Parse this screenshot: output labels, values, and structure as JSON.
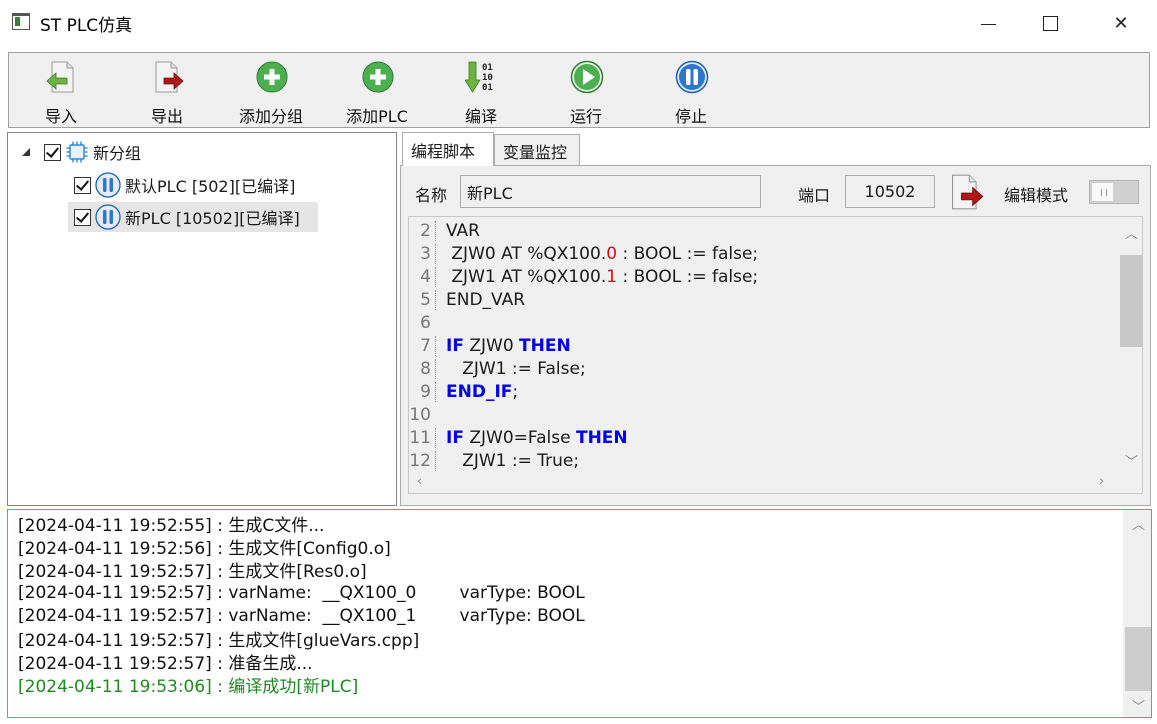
{
  "window": {
    "title": "ST PLC仿真",
    "close_glyph": "✕"
  },
  "toolbar": {
    "buttons": [
      {
        "label": "导入",
        "icon": "import-icon"
      },
      {
        "label": "导出",
        "icon": "export-icon"
      },
      {
        "label": "添加分组",
        "icon": "add-circle-icon"
      },
      {
        "label": "添加PLC",
        "icon": "add-circle-icon"
      },
      {
        "label": "编译",
        "icon": "compile-binary-icon",
        "glyph": "01\n10\n01"
      },
      {
        "label": "运行",
        "icon": "play-icon"
      },
      {
        "label": "停止",
        "icon": "pause-icon"
      }
    ]
  },
  "tree": {
    "group": {
      "label": "新分组",
      "checked": true,
      "icon": "chip-icon"
    },
    "items": [
      {
        "label": "默认PLC [502][已编译]",
        "checked": true,
        "icon": "pause-icon"
      },
      {
        "label": "新PLC [10502][已编译]",
        "checked": true,
        "icon": "pause-icon",
        "selected": true
      }
    ]
  },
  "tabs": [
    {
      "label": "编程脚本",
      "active": true
    },
    {
      "label": "变量监控",
      "active": false
    }
  ],
  "editor_panel": {
    "name_label": "名称",
    "name_value": "新PLC",
    "port_label": "端口",
    "port_value": "10502",
    "edit_mode_label": "编辑模式",
    "export_icon": "export-icon"
  },
  "code": {
    "lines": [
      {
        "n": "2",
        "parts": [
          {
            "t": "VAR"
          }
        ]
      },
      {
        "n": "3",
        "parts": [
          {
            "t": " ZJW0 AT %QX100."
          },
          {
            "t": "0",
            "c": "num"
          },
          {
            "t": " : BOOL := false;"
          }
        ]
      },
      {
        "n": "4",
        "parts": [
          {
            "t": " ZJW1 AT %QX100."
          },
          {
            "t": "1",
            "c": "num"
          },
          {
            "t": " : BOOL := false;"
          }
        ]
      },
      {
        "n": "5",
        "parts": [
          {
            "t": "END_VAR"
          }
        ]
      },
      {
        "n": "6",
        "parts": [
          {
            "t": ""
          }
        ]
      },
      {
        "n": "7",
        "parts": [
          {
            "t": "IF",
            "c": "kw"
          },
          {
            "t": " ZJW0 "
          },
          {
            "t": "THEN",
            "c": "kw"
          }
        ]
      },
      {
        "n": "8",
        "parts": [
          {
            "t": "   ZJW1 := False;"
          }
        ]
      },
      {
        "n": "9",
        "parts": [
          {
            "t": "END_IF",
            "c": "kw"
          },
          {
            "t": ";"
          }
        ]
      },
      {
        "n": "10",
        "parts": [
          {
            "t": ""
          }
        ]
      },
      {
        "n": "11",
        "parts": [
          {
            "t": "IF",
            "c": "kw"
          },
          {
            "t": " ZJW0=False "
          },
          {
            "t": "THEN",
            "c": "kw"
          }
        ]
      },
      {
        "n": "12",
        "parts": [
          {
            "t": "   ZJW1 := True;"
          }
        ]
      }
    ]
  },
  "log": {
    "lines": [
      {
        "text": "[2024-04-11 19:52:55] : 生成C文件...",
        "status": "normal"
      },
      {
        "text": "[2024-04-11 19:52:56] : 生成文件[Config0.o]",
        "status": "normal"
      },
      {
        "text": "[2024-04-11 19:52:57] : 生成文件[Res0.o]",
        "status": "normal"
      },
      {
        "text": "[2024-04-11 19:52:57] : varName:  __QX100_0        varType: BOOL",
        "status": "normal"
      },
      {
        "text": "[2024-04-11 19:52:57] : varName:  __QX100_1        varType: BOOL",
        "status": "normal"
      },
      {
        "text": "[2024-04-11 19:52:57] : 生成文件[glueVars.cpp]",
        "status": "normal"
      },
      {
        "text": "[2024-04-11 19:52:57] : 准备生成...",
        "status": "normal"
      },
      {
        "text": "[2024-04-11 19:53:06] : 编译成功[新PLC]",
        "status": "success"
      }
    ]
  },
  "colors": {
    "success": "#1f8a1f",
    "keyword": "#0000ee",
    "number": "#d01010",
    "accent_green": "#4caf50",
    "accent_blue": "#1e5fb4",
    "export_red": "#b01818"
  }
}
